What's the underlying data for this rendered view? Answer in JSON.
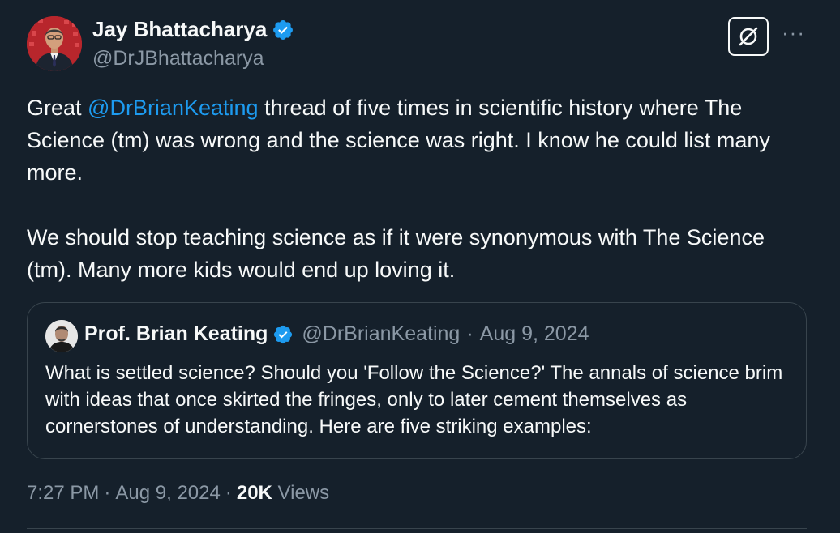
{
  "author": {
    "name": "Jay Bhattacharya",
    "handle": "@DrJBhattacharya",
    "verified": true
  },
  "icons": {
    "verified": "verified-badge-icon",
    "grok": "grok-icon",
    "more": "more-options-icon"
  },
  "colors": {
    "background": "#15202b",
    "text": "#f7f9f9",
    "secondary": "#8b98a5",
    "accent": "#1d9bf0",
    "border": "#38444d"
  },
  "tweet": {
    "p1_before": "Great ",
    "mention": "@DrBrianKeating",
    "p1_after": " thread of five times in scientific history where The Science (tm) was wrong and the science was right. I know he could list many more.",
    "p2": "We should stop teaching science as if it were synonymous with The Science (tm). Many more kids would end up loving it."
  },
  "quote": {
    "name": "Prof. Brian Keating",
    "handle": "@DrBrianKeating",
    "separator": "·",
    "date": "Aug 9, 2024",
    "text": "What is settled science? Should you 'Follow the Science?' The annals of science brim with ideas that once skirted the fringes, only to later cement themselves as cornerstones of understanding. Here are five striking examples:"
  },
  "meta": {
    "time": "7:27 PM",
    "separator": "·",
    "date": "Aug 9, 2024",
    "views_count": "20K",
    "views_label": "Views"
  },
  "more_label": "···"
}
